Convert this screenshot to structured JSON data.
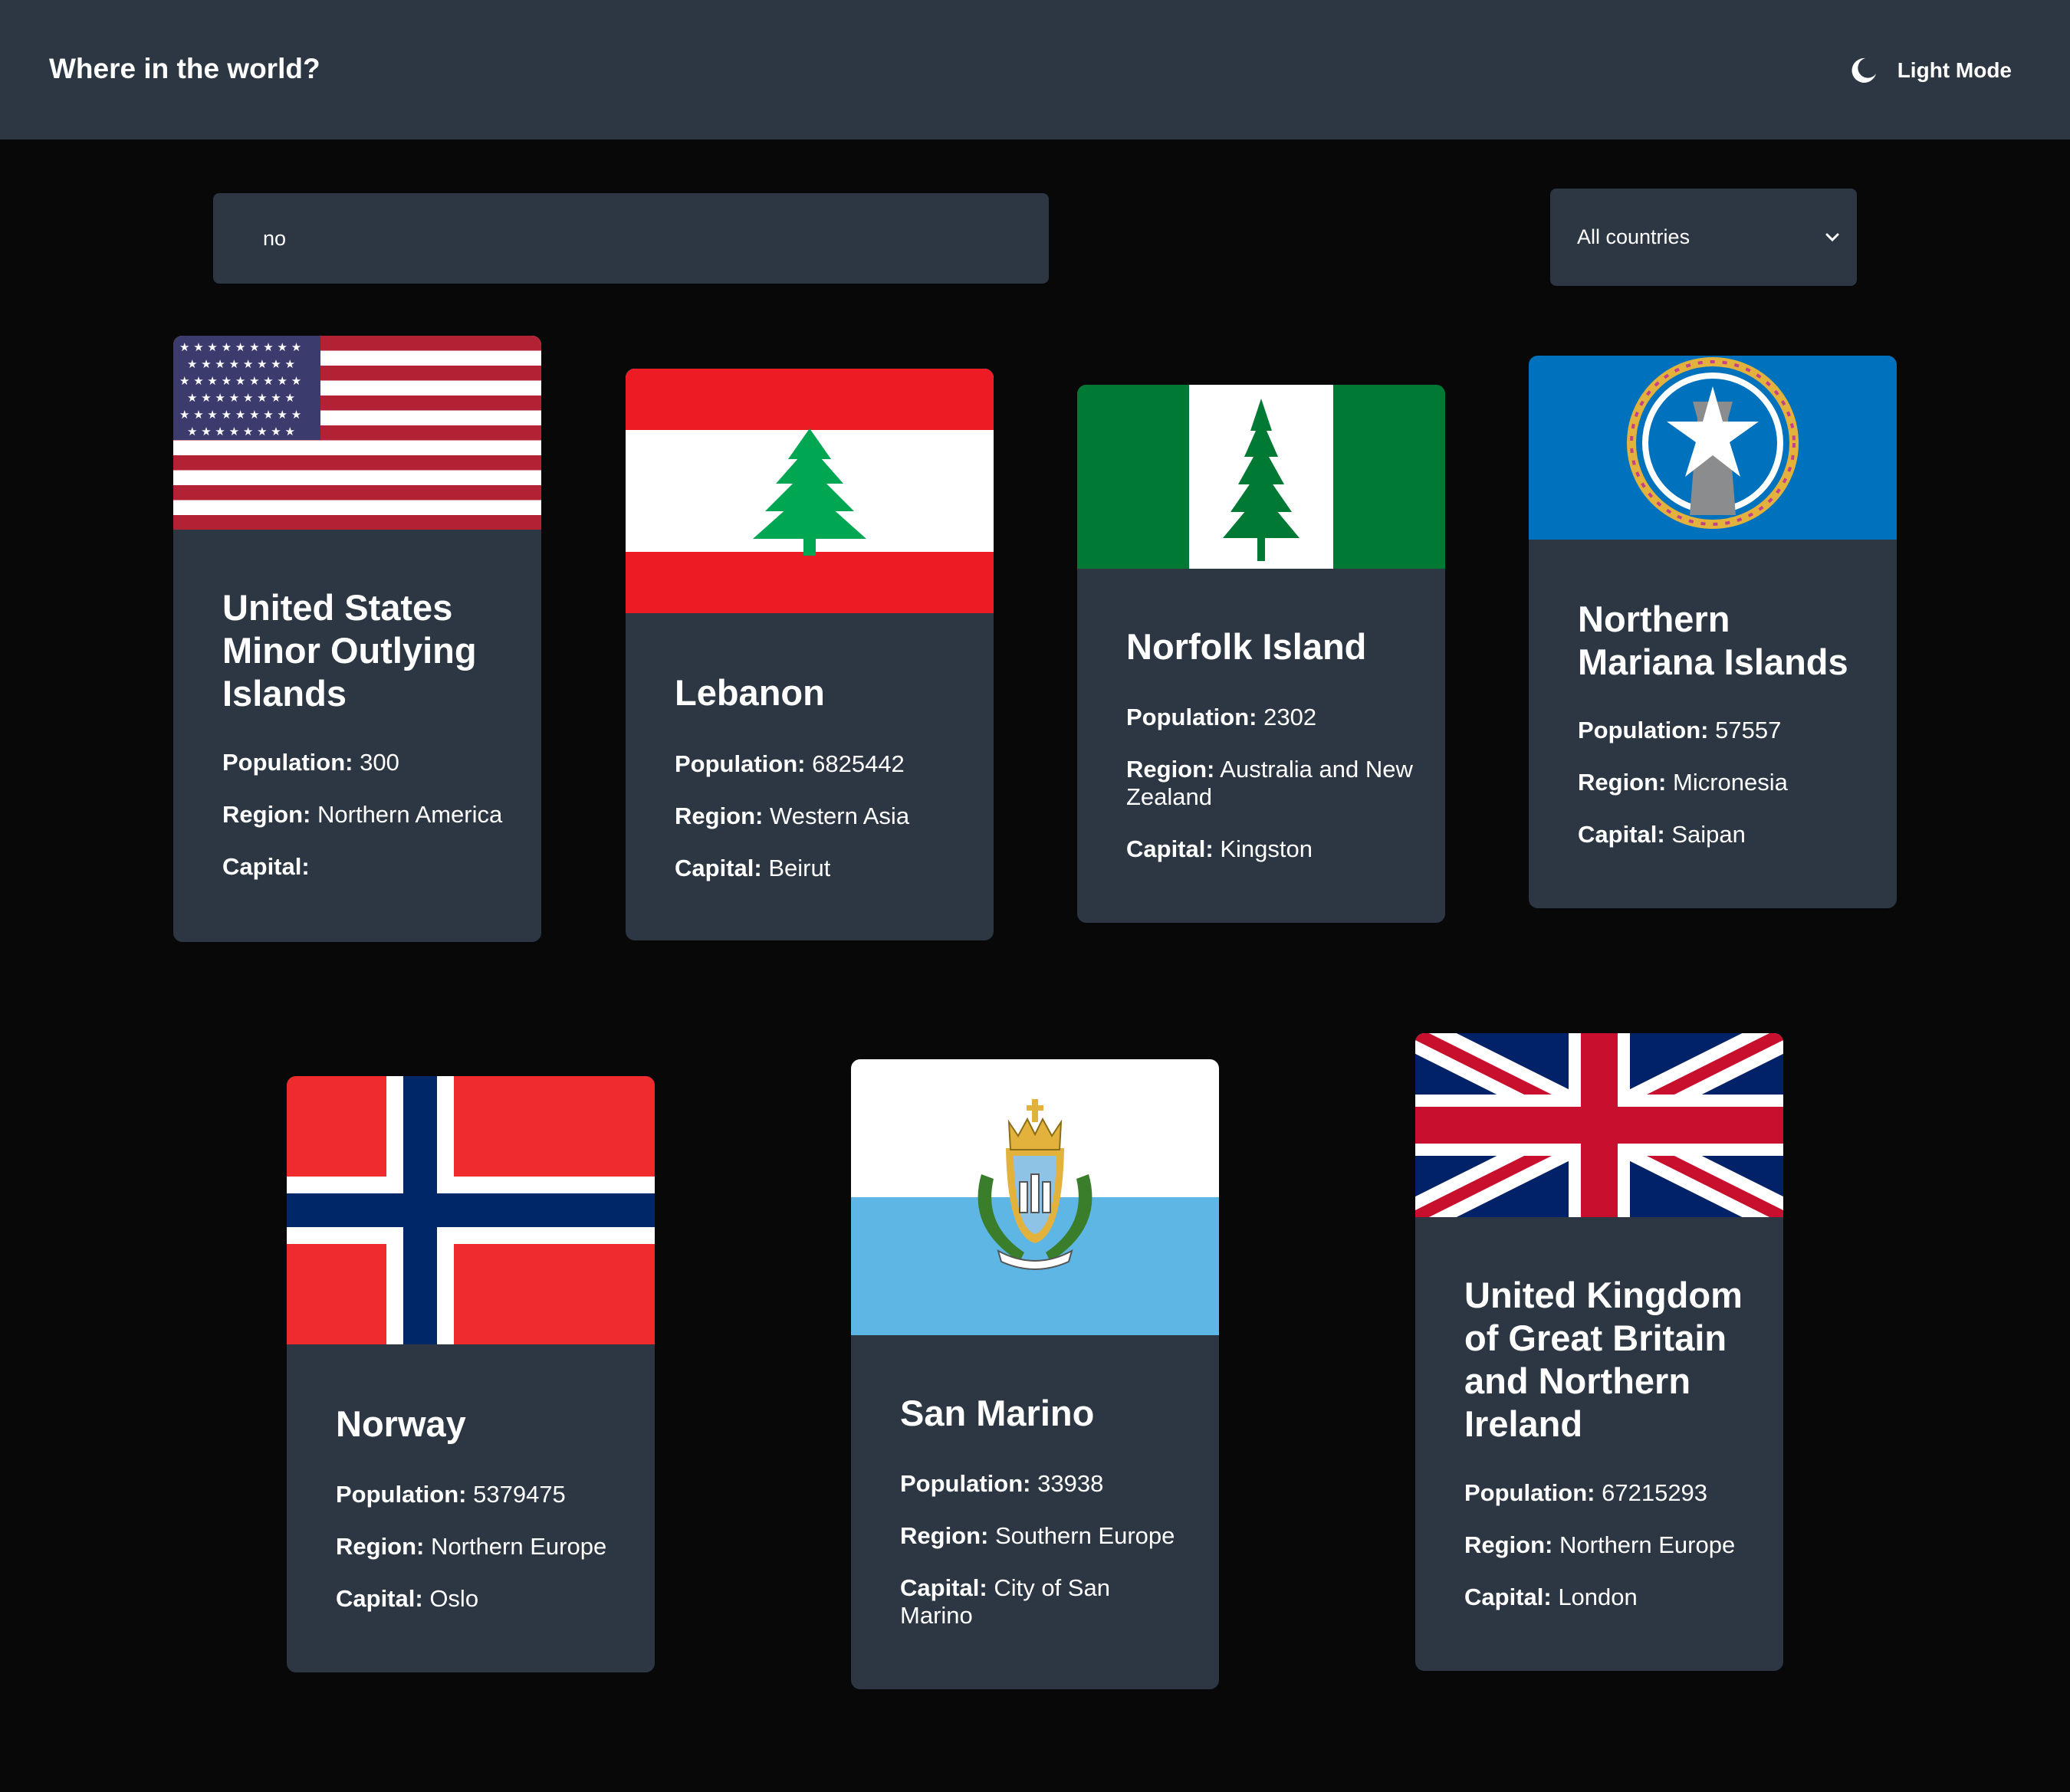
{
  "header": {
    "title": "Where in the world?",
    "mode_label": "Light Mode",
    "mode_icon": "moon-icon"
  },
  "search": {
    "value": "no"
  },
  "filter": {
    "selected": "All countries"
  },
  "labels": {
    "population": "Population:",
    "region": "Region:",
    "capital": "Capital:"
  },
  "countries": [
    {
      "name": "United States Minor Outlying Islands",
      "population": "300",
      "region": "Northern America",
      "capital": "",
      "flag": "united-states-flag"
    },
    {
      "name": "Lebanon",
      "population": "6825442",
      "region": "Western Asia",
      "capital": "Beirut",
      "flag": "lebanon-flag"
    },
    {
      "name": "Norfolk Island",
      "population": "2302",
      "region": "Australia and New Zealand",
      "capital": "Kingston",
      "flag": "norfolk-island-flag"
    },
    {
      "name": "Northern Mariana Islands",
      "population": "57557",
      "region": "Micronesia",
      "capital": "Saipan",
      "flag": "northern-mariana-islands-flag"
    },
    {
      "name": "Norway",
      "population": "5379475",
      "region": "Northern Europe",
      "capital": "Oslo",
      "flag": "norway-flag"
    },
    {
      "name": "San Marino",
      "population": "33938",
      "region": "Southern Europe",
      "capital": "City of San Marino",
      "flag": "san-marino-flag"
    },
    {
      "name": "United Kingdom of Great Britain and Northern Ireland",
      "population": "67215293",
      "region": "Northern Europe",
      "capital": "London",
      "flag": "united-kingdom-flag"
    }
  ],
  "colors": {
    "background": "#080808",
    "surface": "#2c3743",
    "text": "#ffffff"
  }
}
